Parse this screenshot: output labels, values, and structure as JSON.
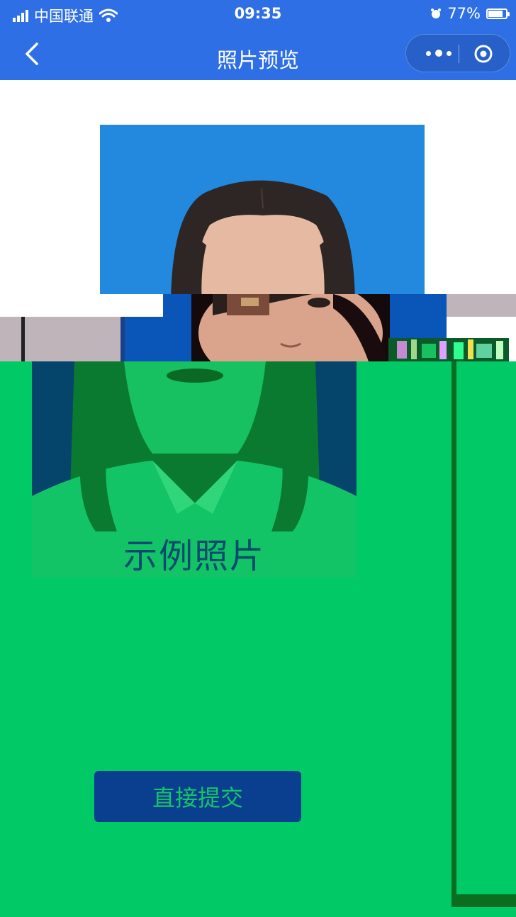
{
  "status_bar": {
    "carrier": "中国联通",
    "time": "09:35",
    "battery": "77%"
  },
  "nav": {
    "title": "照片预览"
  },
  "photo": {
    "caption": "示例照片"
  },
  "actions": {
    "submit_label": "直接提交"
  },
  "colors": {
    "nav_bg": "#2f6fe6",
    "photo_bg": "#2389de",
    "overlay_green": "#00c966",
    "button_bg": "#0a3f8f"
  }
}
